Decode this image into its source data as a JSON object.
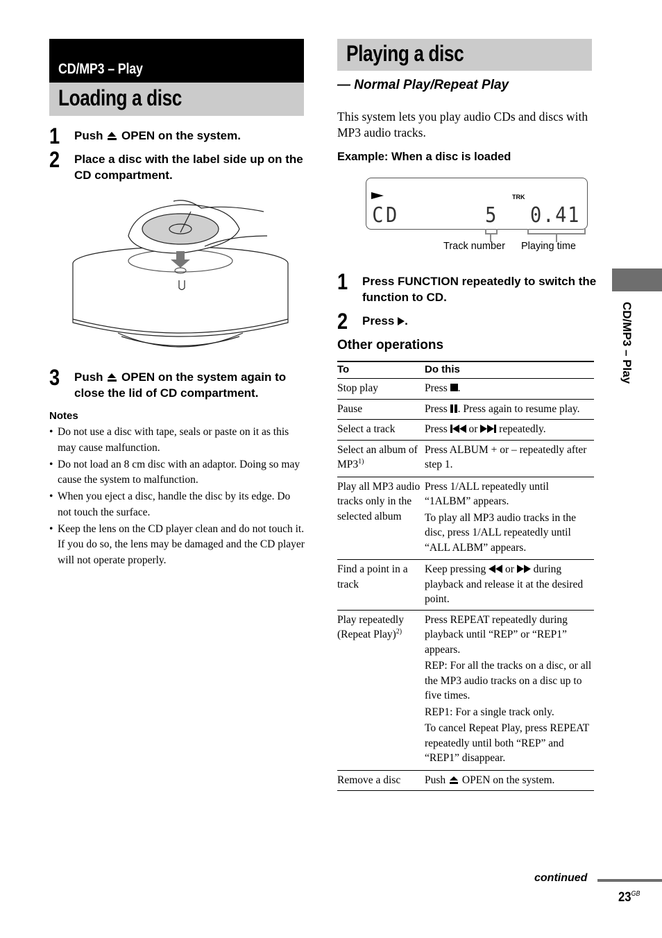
{
  "left": {
    "section_label": "CD/MP3 – Play",
    "title": "Loading a disc",
    "steps": [
      {
        "num": "1",
        "before": "Push",
        "after": "OPEN on the system."
      },
      {
        "num": "2",
        "text": "Place a disc with the label side up on the CD compartment."
      },
      {
        "num": "3",
        "before": "Push",
        "after": "OPEN on the system again to close the lid of CD compartment."
      }
    ],
    "notes_title": "Notes",
    "notes": [
      "Do not use a disc with tape, seals or paste on it as this may cause malfunction.",
      "Do not load an 8 cm disc with an adaptor. Doing so may cause the system to malfunction.",
      "When you eject a disc, handle the disc by its edge. Do not touch the surface.",
      "Keep the lens on the CD player clean and do not touch it. If you do so, the lens may be damaged and the CD player will not operate properly."
    ]
  },
  "right": {
    "title": "Playing a disc",
    "subtitle": "— Normal Play/Repeat Play",
    "intro": "This system lets you play audio CDs and discs with MP3 audio tracks.",
    "example_label": "Example: When a disc is loaded",
    "display": {
      "indicator": "TRK",
      "source": "CD",
      "track": "5",
      "time": "0.41",
      "track_label": "Track number",
      "time_label": "Playing time"
    },
    "steps": [
      {
        "num": "1",
        "text": "Press FUNCTION repeatedly to switch the function to CD."
      },
      {
        "num": "2",
        "before": "Press",
        "after": "."
      }
    ],
    "table_title": "Other operations",
    "table": {
      "headers": [
        "To",
        "Do this"
      ],
      "rows": [
        {
          "to": "Stop play",
          "do_before": "Press",
          "do_after": "."
        },
        {
          "to": "Pause",
          "do_before": "Press",
          "do_after": ". Press again to resume play."
        },
        {
          "to": "Select a track",
          "do_before": "Press",
          "do_mid": "or",
          "do_after": "repeatedly."
        },
        {
          "to": "Select an album of MP3",
          "to_sup": "1)",
          "do": [
            "Press ALBUM + or – repeatedly after step 1."
          ]
        },
        {
          "to": "Play all MP3 audio tracks only in the selected album",
          "do": [
            "Press 1/ALL repeatedly until “1ALBM” appears.",
            "To play all MP3 audio tracks in the disc, press 1/ALL repeatedly until “ALL ALBM” appears."
          ]
        },
        {
          "to": "Find a point in a track",
          "do_before": "Keep pressing",
          "do_mid": "or",
          "do_after": "during playback and release it at the desired point."
        },
        {
          "to": "Play repeatedly (Repeat Play)",
          "to_sup": "2)",
          "do": [
            "Press REPEAT repeatedly during playback until “REP” or “REP1” appears.",
            "REP: For all the tracks on a disc, or all the MP3 audio tracks on a disc up to five times.",
            "REP1: For a single track only.",
            "To cancel Repeat Play, press REPEAT repeatedly until both “REP” and “REP1” disappear."
          ]
        },
        {
          "to": "Remove a disc",
          "do_before": "Push",
          "do_after": "OPEN on the system."
        }
      ]
    }
  },
  "side_tab": "CD/MP3 – Play",
  "footer": {
    "continued": "continued",
    "page": "23",
    "page_suffix": "GB"
  }
}
